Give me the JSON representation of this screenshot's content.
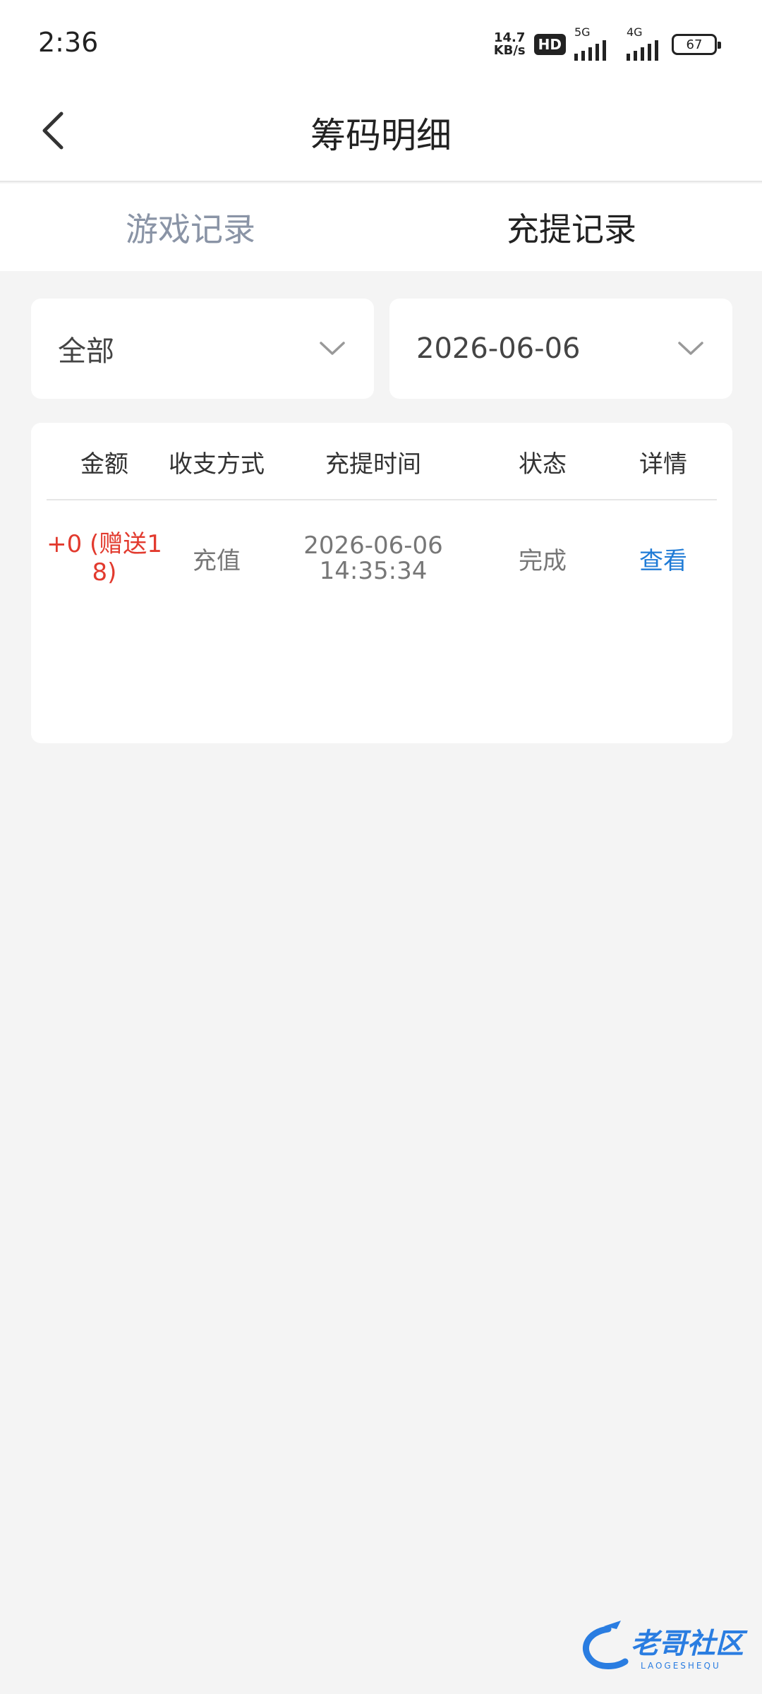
{
  "status_bar": {
    "time": "2:36",
    "net_speed_value": "14.7",
    "net_speed_unit": "KB/s",
    "hd_label": "HD",
    "sig1_label": "5G",
    "sig2_label": "4G",
    "battery": "67"
  },
  "header": {
    "title": "筹码明细"
  },
  "tabs": [
    {
      "label": "游戏记录",
      "active": false
    },
    {
      "label": "充提记录",
      "active": true
    }
  ],
  "filters": {
    "type_value": "全部",
    "date_value": "2026-06-06"
  },
  "table": {
    "columns": [
      "金额",
      "收支方式",
      "充提时间",
      "状态",
      "详情"
    ],
    "rows": [
      {
        "amount_line1": "+0 (赠送1",
        "amount_line2": "8)",
        "method": "充值",
        "date": "2026-06-06",
        "time": "14:35:34",
        "status": "完成",
        "detail": "查看"
      }
    ]
  },
  "watermark": {
    "text": "老哥社区",
    "subtext": "LAOGESHEQU"
  },
  "colors": {
    "amount_red": "#e23a2e",
    "link_blue": "#1f7bd6",
    "inactive_tab": "#8a94a6"
  }
}
